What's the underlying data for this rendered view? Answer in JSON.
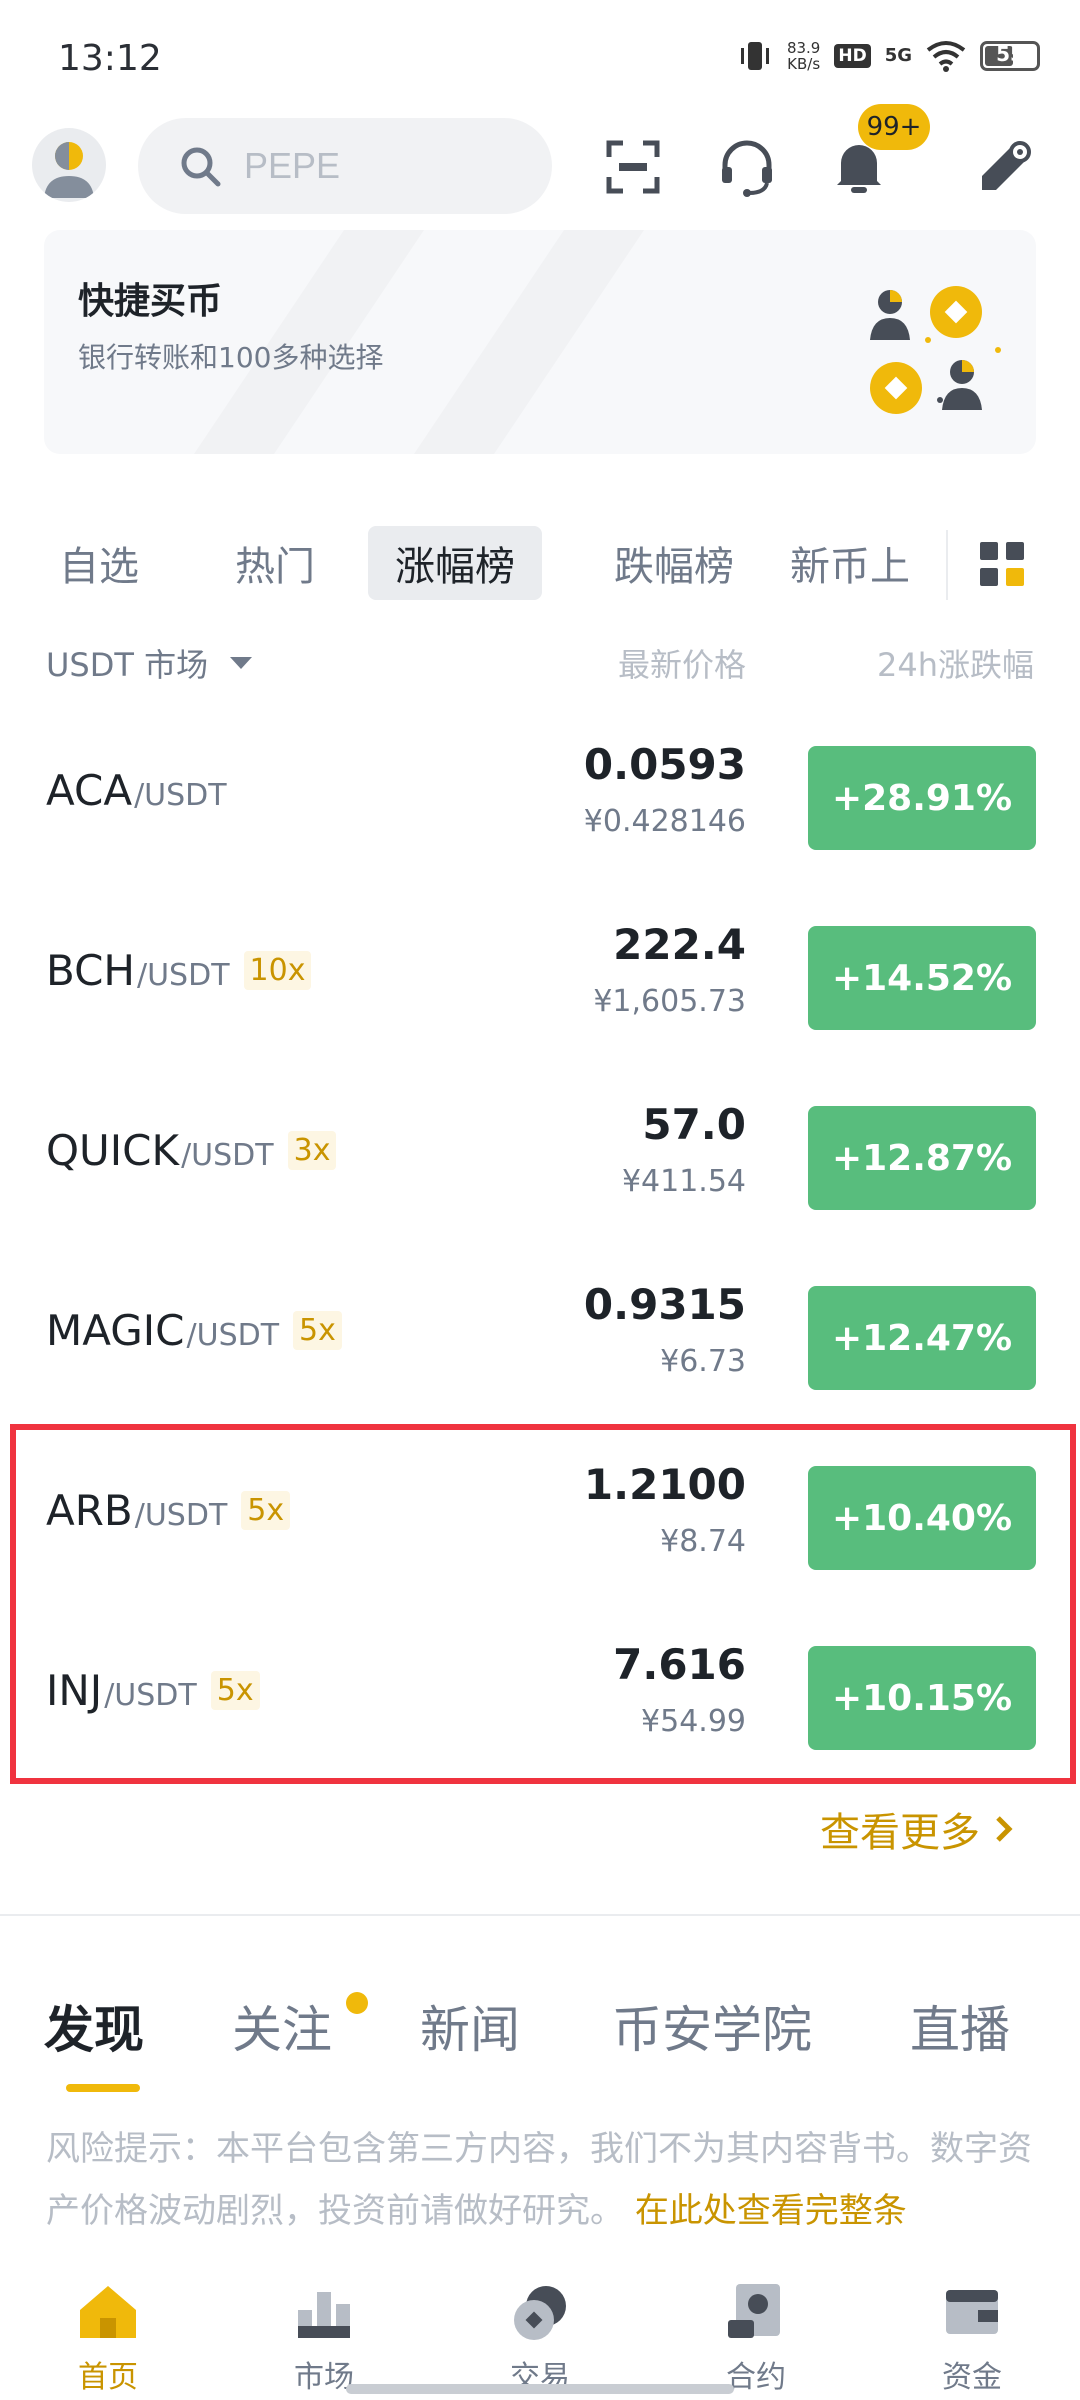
{
  "status_bar": {
    "time": "13:12",
    "net_speed_value": "83.9",
    "net_speed_unit": "KB/s",
    "hd_badge": "HD",
    "network": "5G",
    "battery": "55"
  },
  "header": {
    "search_placeholder": "PEPE",
    "notification_badge": "99+"
  },
  "banner": {
    "title": "快捷买币",
    "subtitle": "银行转账和100多种选择"
  },
  "market_tabs": [
    {
      "label": "自选",
      "active": false
    },
    {
      "label": "热门",
      "active": false
    },
    {
      "label": "涨幅榜",
      "active": true
    },
    {
      "label": "跌幅榜",
      "active": false
    },
    {
      "label": "新币上",
      "active": false
    }
  ],
  "list_header": {
    "market": "USDT 市场",
    "price": "最新价格",
    "change": "24h涨跌幅"
  },
  "rows": [
    {
      "base": "ACA",
      "quote": "/USDT",
      "leverage": "",
      "price": "0.0593",
      "fiat": "¥0.428146",
      "change": "+28.91%"
    },
    {
      "base": "BCH",
      "quote": "/USDT",
      "leverage": "10x",
      "price": "222.4",
      "fiat": "¥1,605.73",
      "change": "+14.52%"
    },
    {
      "base": "QUICK",
      "quote": "/USDT",
      "leverage": "3x",
      "price": "57.0",
      "fiat": "¥411.54",
      "change": "+12.87%"
    },
    {
      "base": "MAGIC",
      "quote": "/USDT",
      "leverage": "5x",
      "price": "0.9315",
      "fiat": "¥6.73",
      "change": "+12.47%"
    },
    {
      "base": "ARB",
      "quote": "/USDT",
      "leverage": "5x",
      "price": "1.2100",
      "fiat": "¥8.74",
      "change": "+10.40%"
    },
    {
      "base": "INJ",
      "quote": "/USDT",
      "leverage": "5x",
      "price": "7.616",
      "fiat": "¥54.99",
      "change": "+10.15%"
    }
  ],
  "view_more": "查看更多",
  "feed_tabs": [
    {
      "label": "发现",
      "active": true
    },
    {
      "label": "关注",
      "active": false
    },
    {
      "label": "新闻",
      "active": false
    },
    {
      "label": "币安学院",
      "active": false
    },
    {
      "label": "直播",
      "active": false
    }
  ],
  "risk_notice": {
    "text": "风险提示：本平台包含第三方内容，我们不为其内容背书。数字资产价格波动剧烈，投资前请做好研究。",
    "link": "在此处查看完整条"
  },
  "bottom_nav": [
    {
      "label": "首页",
      "icon": "home-icon",
      "active": true
    },
    {
      "label": "市场",
      "icon": "market-icon",
      "active": false
    },
    {
      "label": "交易",
      "icon": "trade-icon",
      "active": false
    },
    {
      "label": "合约",
      "icon": "futures-icon",
      "active": false
    },
    {
      "label": "资金",
      "icon": "wallet-icon",
      "active": false
    }
  ],
  "colors": {
    "accent": "#f0b90b",
    "accent_text": "#c99400",
    "up_green": "#58bd7d",
    "highlight_red": "#f0333f"
  }
}
